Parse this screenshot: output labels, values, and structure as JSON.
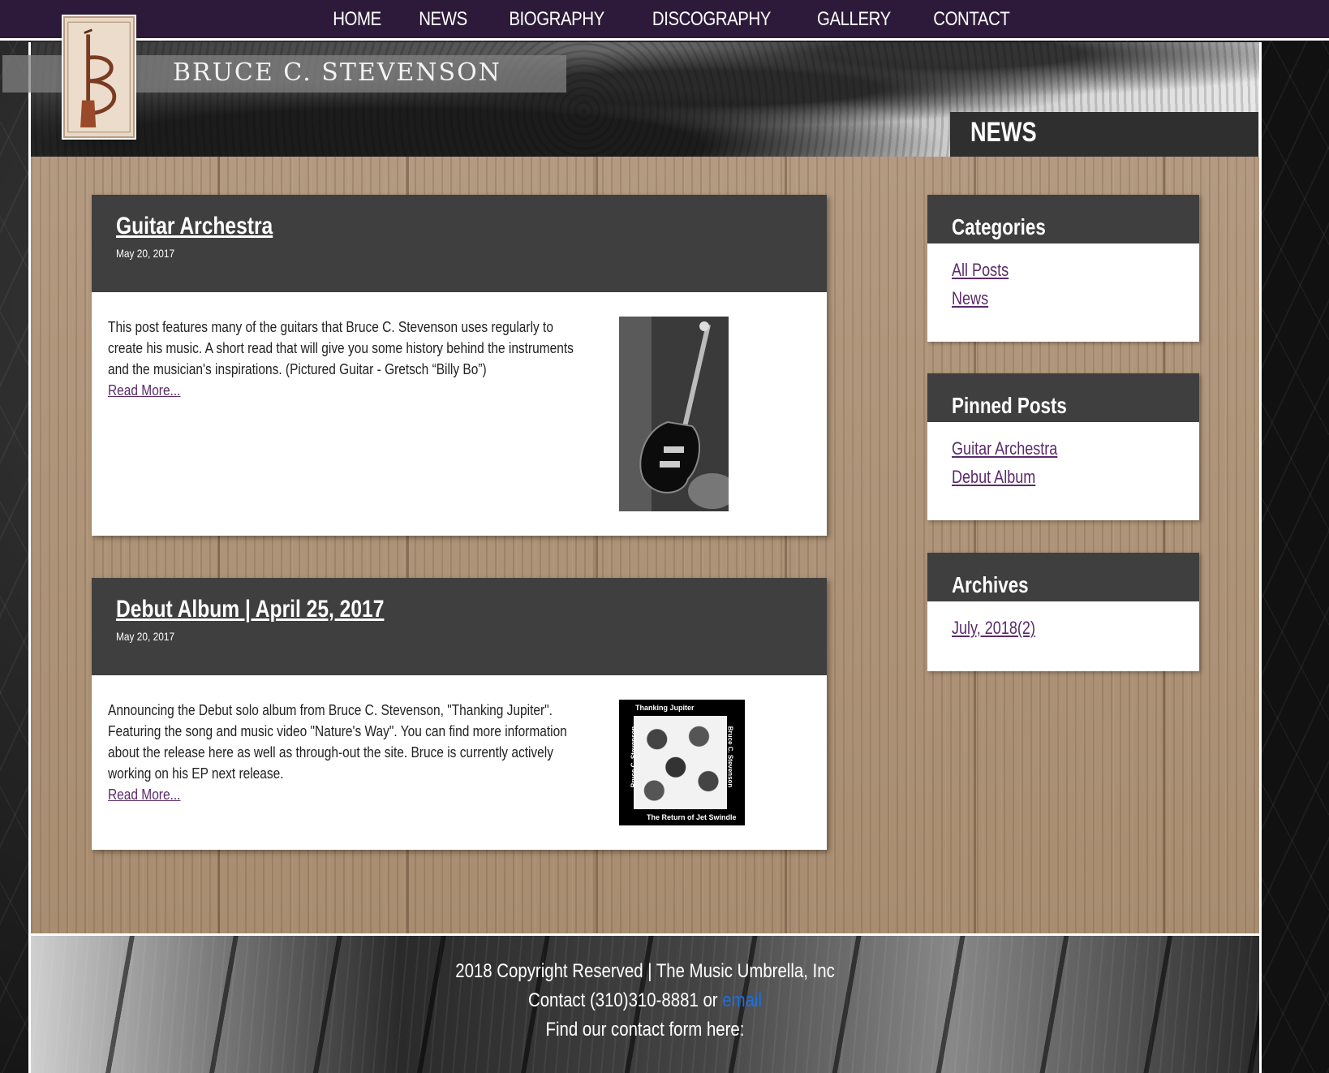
{
  "nav": {
    "items": [
      "HOME",
      "NEWS",
      "BIOGRAPHY",
      "DISCOGRAPHY",
      "GALLERY",
      "CONTACT"
    ]
  },
  "header": {
    "site_title": "BRUCE C. STEVENSON",
    "page_heading": "NEWS"
  },
  "posts": [
    {
      "title": "Guitar Archestra",
      "date": "May 20, 2017",
      "excerpt": "This post features many of the guitars that Bruce C. Stevenson uses regularly to create his music. A short read that will give you some history behind the instruments and the musician's inspirations. (Pictured Guitar - Gretsch “Billy Bo”)",
      "read_more": "Read More..."
    },
    {
      "title": "Debut Album | April 25, 2017",
      "date": "May 20, 2017",
      "excerpt": "Announcing the Debut solo album from Bruce C. Stevenson, \"Thanking Jupiter\". Featuring the song and music video \"Nature's Way\". You can find more information about the release here as well as through-out the site. Bruce is currently actively working on his EP next release.",
      "read_more": "Read More...",
      "album_cover": {
        "top_text": "Thanking Jupiter",
        "bottom_text": "The Return of Jet Swindle",
        "side_text": "Bruce C. Stevenson"
      }
    }
  ],
  "sidebar": {
    "categories": {
      "title": "Categories",
      "items": [
        "All Posts",
        "News"
      ]
    },
    "pinned": {
      "title": "Pinned Posts",
      "items": [
        "Guitar Archestra",
        "Debut Album"
      ]
    },
    "archives": {
      "title": "Archives",
      "items": [
        "July, 2018(2)"
      ]
    }
  },
  "footer": {
    "copyright": "2018 Copyright Reserved | The Music Umbrella, Inc",
    "contact_prefix": "Contact (310)310-8881 or",
    "email_link": "email",
    "form_line": "Find our contact form here:"
  },
  "colors": {
    "nav_bg": "#2d1a3a",
    "link": "#5a2a6a",
    "email_link": "#1a6fe0",
    "panel_dark": "#3f3f3f"
  }
}
